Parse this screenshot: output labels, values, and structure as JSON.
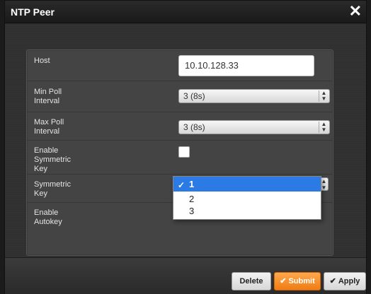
{
  "dialog": {
    "title": "NTP Peer",
    "close_icon": "✕"
  },
  "form": {
    "host": {
      "label": "Host",
      "value": "10.10.128.33"
    },
    "min_poll": {
      "label": "Min Poll\nInterval",
      "value": "3 (8s)"
    },
    "max_poll": {
      "label": "Max Poll\nInterval",
      "value": "3 (8s)"
    },
    "enable_symmetric_key": {
      "label": "Enable\nSymmetric\nKey",
      "checked": false
    },
    "symmetric_key": {
      "label": "Symmetric\nKey",
      "options": [
        "1",
        "2",
        "3"
      ],
      "selected": "1"
    },
    "enable_autokey": {
      "label": "Enable\nAutokey"
    }
  },
  "footer": {
    "delete_label": "Delete",
    "submit_label": "Submit",
    "apply_label": "Apply",
    "check_glyph": "✔"
  },
  "colors": {
    "accent_orange": "#f07b12",
    "selection_blue": "#2c7be5"
  }
}
